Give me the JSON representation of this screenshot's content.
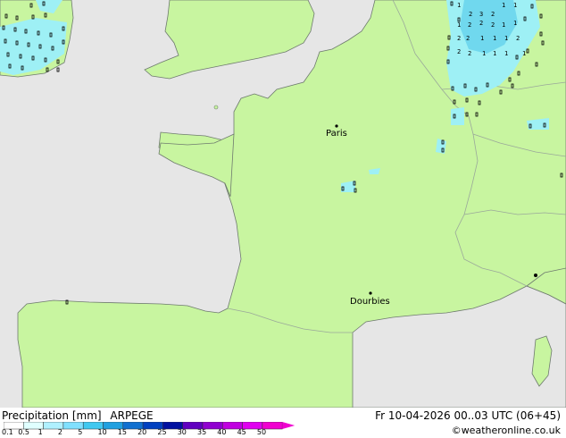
{
  "map": {
    "colors": {
      "sea": "#e6e6e6",
      "land": "#c8f5a0",
      "border": "#9aa89a",
      "coast": "#6e7a6e"
    },
    "cities": [
      {
        "name": "Paris"
      },
      {
        "name": "Dourbies"
      }
    ],
    "precip_numbers": [
      "1",
      "2",
      "3",
      "2",
      "1",
      "1",
      "1",
      "2",
      "2",
      "2",
      "1",
      "1",
      "2",
      "2",
      "1",
      "1",
      "1",
      "2",
      "2",
      "2",
      "1",
      "1",
      "1",
      "1"
    ]
  },
  "footer": {
    "title": "Precipitation [mm]",
    "model": "ARPEGE",
    "datetime": "Fr 10-04-2026 00..03 UTC (06+45)",
    "credit": "©weatheronline.co.uk",
    "legend": {
      "labels": [
        "0.1",
        "0.5",
        "1",
        "2",
        "5",
        "10",
        "15",
        "20",
        "25",
        "30",
        "35",
        "40",
        "45",
        "50"
      ],
      "colors": [
        "#ffffff",
        "#e0ffff",
        "#b0f0ff",
        "#80e0ff",
        "#40c8f0",
        "#20a0e0",
        "#1070d0",
        "#0040c0",
        "#0010a0",
        "#6000c0",
        "#9000d0",
        "#c000e0",
        "#e000f0",
        "#f000d0"
      ]
    }
  }
}
